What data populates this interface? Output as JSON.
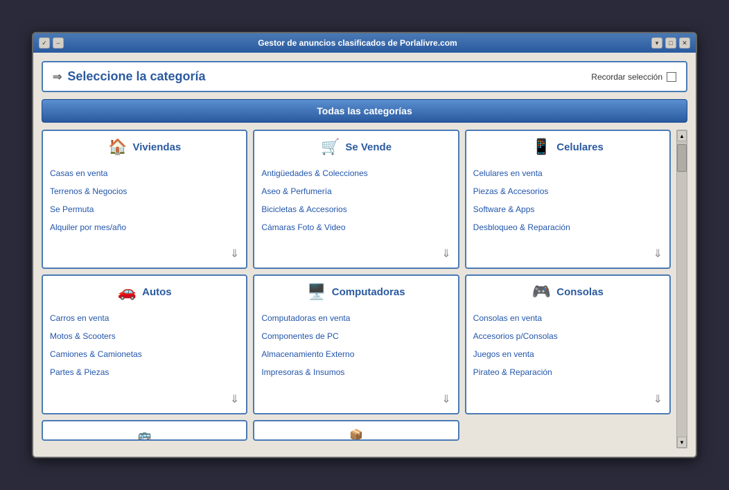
{
  "window": {
    "title": "Gestor de anuncios clasificados de Porlalivre.com",
    "controls_left": [
      "✓",
      "–"
    ],
    "controls_right": [
      "▾",
      "□",
      "✕"
    ]
  },
  "header": {
    "arrow": "⇒",
    "title": "Seleccione la categoría",
    "remember_label": "Recordar selección"
  },
  "all_categories_btn": "Todas las categorías",
  "categories": [
    {
      "id": "viviendas",
      "icon": "🏠",
      "title": "Viviendas",
      "items": [
        "Casas en venta",
        "Terrenos & Negocios",
        "Se Permuta",
        "Alquiler por mes/año"
      ]
    },
    {
      "id": "se-vende",
      "icon": "🛒",
      "title": "Se Vende",
      "items": [
        "Antigüedades & Colecciones",
        "Aseo & Perfumería",
        "Bicicletas & Accesorios",
        "Cámaras Foto & Video"
      ]
    },
    {
      "id": "celulares",
      "icon": "📱",
      "title": "Celulares",
      "items": [
        "Celulares en venta",
        "Piezas & Accesorios",
        "Software & Apps",
        "Desbloqueo & Reparación"
      ]
    },
    {
      "id": "autos",
      "icon": "🚗",
      "title": "Autos",
      "items": [
        "Carros en venta",
        "Motos & Scooters",
        "Camiones & Camionetas",
        "Partes & Piezas"
      ]
    },
    {
      "id": "computadoras",
      "icon": "🖥️",
      "title": "Computadoras",
      "items": [
        "Computadoras en venta",
        "Componentes de PC",
        "Almacenamiento Externo",
        "Impresoras & Insumos"
      ]
    },
    {
      "id": "consolas",
      "icon": "🎮",
      "title": "Consolas",
      "items": [
        "Consolas en venta",
        "Accesorios p/Consolas",
        "Juegos en venta",
        "Pirateo & Reparación"
      ]
    }
  ]
}
